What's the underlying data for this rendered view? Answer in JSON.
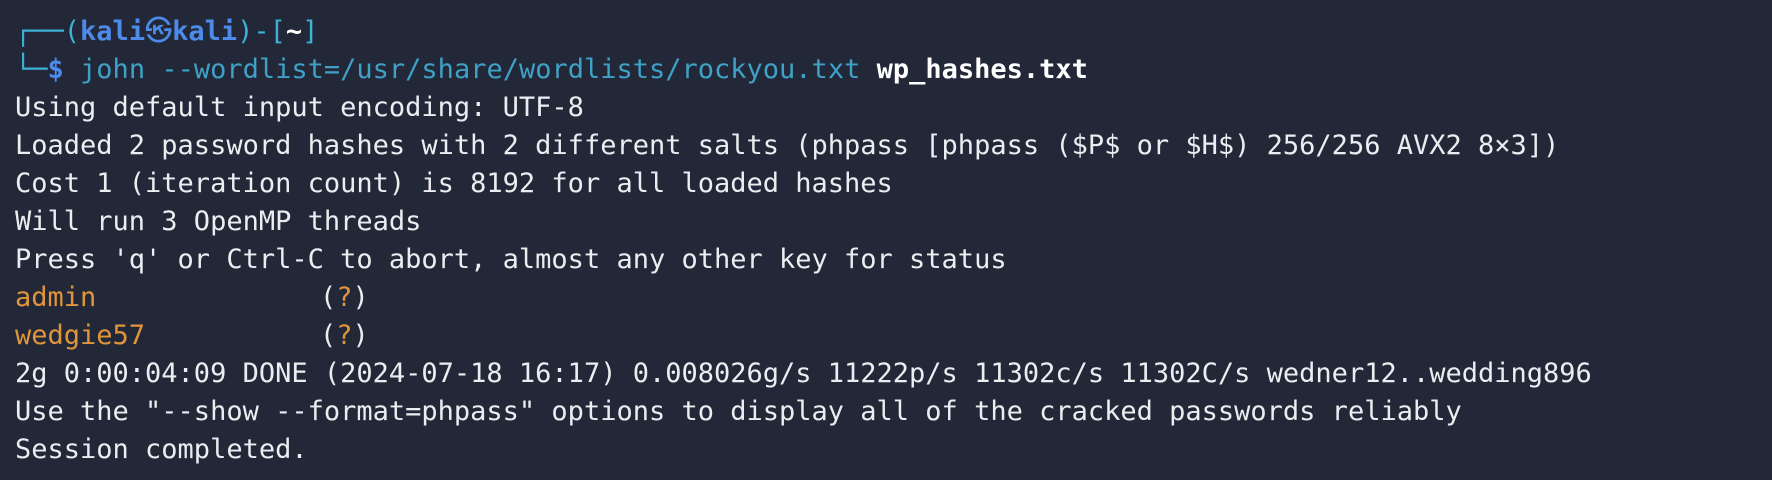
{
  "prompt": {
    "corner_top": "┌──",
    "open_paren": "(",
    "user": "kali",
    "at_symbol": "㉿",
    "host": "kali",
    "close_paren": ")-[",
    "cwd": "~",
    "close_bracket": "]",
    "corner_bottom": "└─",
    "dollar": "$"
  },
  "command": {
    "program": "john",
    "args": "--wordlist=/usr/share/wordlists/rockyou.txt",
    "target": "wp_hashes.txt"
  },
  "output": {
    "lines_before": [
      "Using default input encoding: UTF-8",
      "Loaded 2 password hashes with 2 different salts (phpass [phpass ($P$ or $H$) 256/256 AVX2 8×3])",
      "Cost 1 (iteration count) is 8192 for all loaded hashes",
      "Will run 3 OpenMP threads",
      "Press 'q' or Ctrl-C to abort, almost any other key for status"
    ],
    "cracked": [
      {
        "password": "admin",
        "user_open": "(",
        "user": "?",
        "user_close": ")"
      },
      {
        "password": "wedgie57",
        "user_open": "(",
        "user": "?",
        "user_close": ")"
      }
    ],
    "lines_after": [
      "2g 0:00:04:09 DONE (2024-07-18 16:17) 0.008026g/s 11222p/s 11302c/s 11302C/s wedner12..wedding896",
      "Use the \"--show --format=phpass\" options to display all of the cracked passwords reliably",
      "Session completed."
    ]
  },
  "colors": {
    "background": "#232838",
    "text": "#ebedf0",
    "prompt_blue": "#4d8bea",
    "prompt_box": "#3eb1d6",
    "command_cyan": "#3fa1c6",
    "cracked_orange": "#e0953a"
  }
}
